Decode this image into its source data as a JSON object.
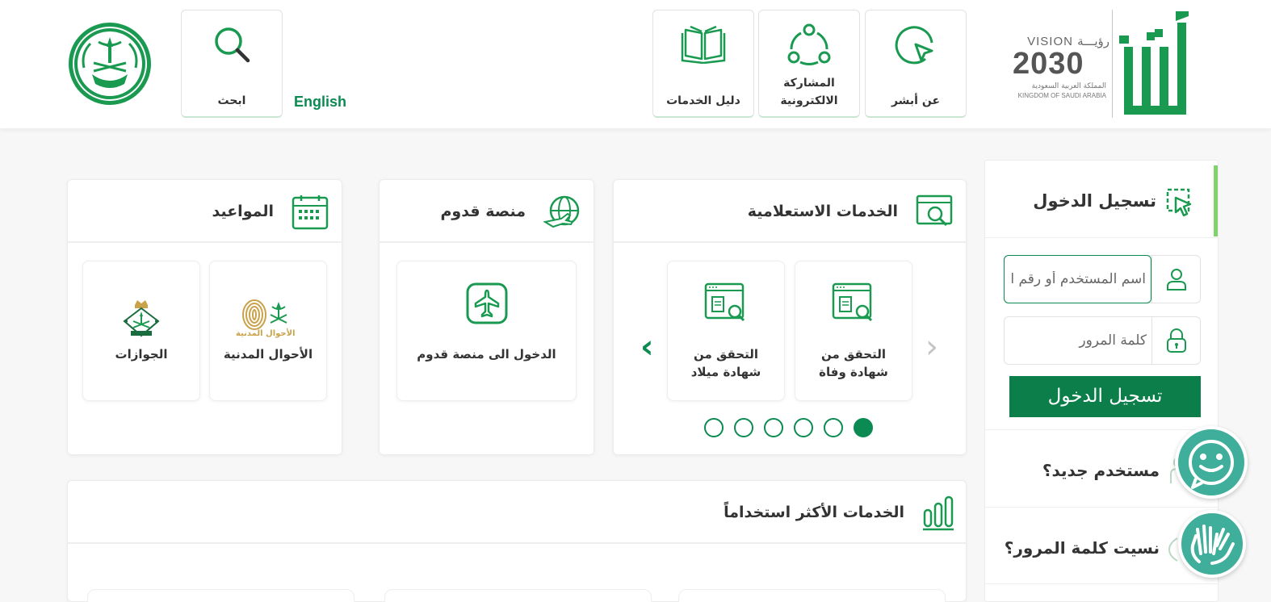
{
  "header": {
    "nav": [
      {
        "label": "عن أبشر",
        "icon": "cursor-circle-icon"
      },
      {
        "label_line1": "المشاركة",
        "label_line2": "الالكترونية",
        "icon": "share-network-icon"
      },
      {
        "label": "دليل الخدمات",
        "icon": "book-icon"
      }
    ],
    "search_label": "ابحث",
    "language_link": "English",
    "vision": {
      "top": "VISION رؤيـــة",
      "year": "2030",
      "arabic": "المملكة العربية السعودية",
      "english": "KINGDOM OF SAUDI ARABIA"
    }
  },
  "panels": {
    "inquiry": {
      "title": "الخدمات الاستعلامية",
      "tiles": [
        {
          "line1": "التحقق من",
          "line2": "شهادة وفاة"
        },
        {
          "line1": "التحقق من",
          "line2": "شهادة ميلاد"
        }
      ],
      "dot_count": 6,
      "active_dot": 0
    },
    "qudoom": {
      "title": "منصة قدوم",
      "tiles": [
        {
          "label": "الدخول الى منصة قدوم"
        }
      ]
    },
    "appointments": {
      "title": "المواعيد",
      "tiles": [
        {
          "label": "الأحوال المدنية",
          "logo_text": "الأحوال المدنية"
        },
        {
          "label": "الجوازات"
        }
      ]
    },
    "most_used": {
      "title": "الخدمات الأكثر استخداماً"
    }
  },
  "login": {
    "title": "تسجيل الدخول",
    "username_placeholder": "اسم المستخدم أو رقم الهوية",
    "password_placeholder": "كلمة المرور",
    "submit": "تسجيل الدخول",
    "new_user": "مستخدم جديد؟",
    "forgot_password": "نسيت كلمة المرور؟"
  },
  "colors": {
    "brand": "#0b8a52",
    "brand_dark": "#0b7e4a",
    "accent_bar": "#7ed36b",
    "float": "#3fae9a"
  }
}
